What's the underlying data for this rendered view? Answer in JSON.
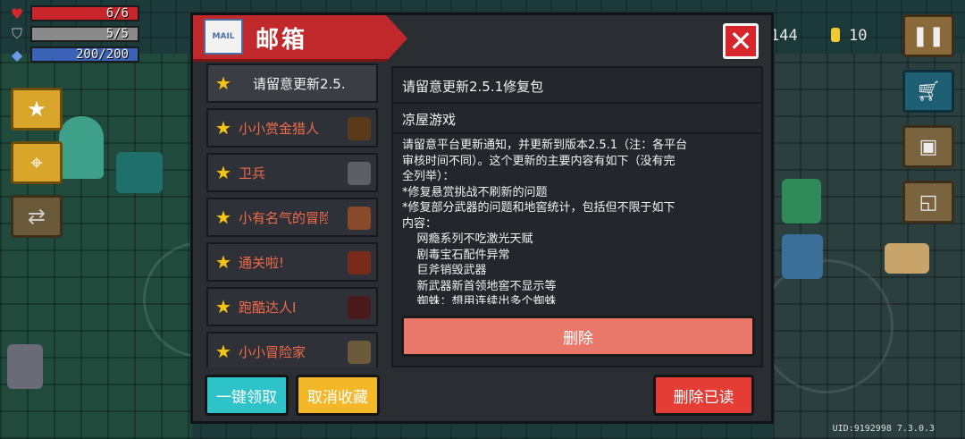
{
  "hud": {
    "health": "6/6",
    "health_fill": 1.0,
    "armor": "5/5",
    "armor_fill": 1.0,
    "energy": "200/200",
    "energy_fill": 1.0,
    "gems_partial": "144",
    "coins": "10",
    "uid": "UID:9192998 7.3.0.3"
  },
  "mailbox": {
    "title": "邮箱",
    "mail_icon_text": "MAIL",
    "close_label": "✕",
    "items": [
      {
        "label": "请留意更新2.5.",
        "icon": "star-icon"
      },
      {
        "label": "小小赏金猎人",
        "icon": "star-icon"
      },
      {
        "label": "卫兵",
        "icon": "star-icon"
      },
      {
        "label": "小有名气的冒险",
        "icon": "star-icon"
      },
      {
        "label": "通关啦!",
        "icon": "star-icon"
      },
      {
        "label": "跑酷达人I",
        "icon": "star-icon"
      },
      {
        "label": "小小冒险家",
        "icon": "star-icon"
      }
    ],
    "detail": {
      "subject": "请留意更新2.5.1修复包",
      "sender": "凉屋游戏",
      "body": "请留意平台更新通知，并更新到版本2.5.1（注：各平台\n审核时间不同）。这个更新的主要内容有如下（没有完\n全列举）：\n*修复悬赏挑战不刷新的问题\n*修复部分武器的问题和地窖统计，包括但不限于如下\n内容：\n    网瘾系列不吃激光天赋\n    剧毒宝石配件异常\n    巨斧销毁武器\n    新武器新首领地窖不显示等\n    蜘蛛：想用连续出多个蜘蛛"
    },
    "delete_label": "删除",
    "claim_all_label": "一键领取",
    "unfavorite_label": "取消收藏",
    "delete_read_label": "删除已读"
  },
  "colors": {
    "health": "#c8262a",
    "armor": "#8a8a8a",
    "energy": "#3a63b8",
    "ribbon": "#c0282c"
  }
}
